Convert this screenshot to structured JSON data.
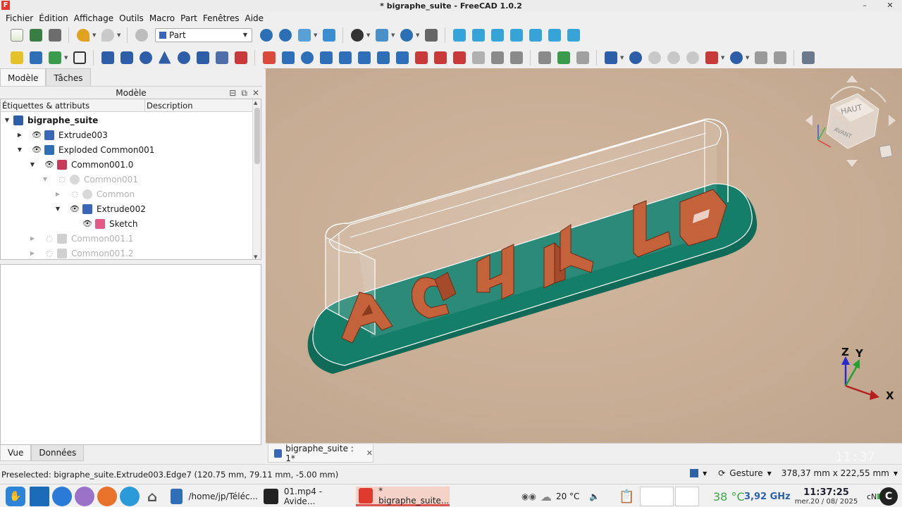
{
  "window": {
    "title": "* bigraphe_suite - FreeCAD 1.0.2",
    "minimize": "–",
    "close": "✕"
  },
  "menu": [
    "Fichier",
    "Édition",
    "Affichage",
    "Outils",
    "Macro",
    "Part",
    "Fenêtres",
    "Aide"
  ],
  "workbench": {
    "selected": "Part"
  },
  "left_panel": {
    "top_tabs": [
      "Modèle",
      "Tâches"
    ],
    "model_header": "Modèle",
    "columns": [
      "Étiquettes & attributs",
      "Description"
    ],
    "tree": [
      {
        "label": "bigraphe_suite",
        "bold": true
      },
      {
        "label": "Extrude003"
      },
      {
        "label": "Exploded Common001"
      },
      {
        "label": "Common001.0"
      },
      {
        "label": "Common001"
      },
      {
        "label": "Common"
      },
      {
        "label": "Extrude002"
      },
      {
        "label": "Sketch"
      },
      {
        "label": "Common001.1"
      },
      {
        "label": "Common001.2"
      }
    ],
    "bottom_tabs": [
      "Vue",
      "Données"
    ]
  },
  "navcube": {
    "top_face": "HAUT",
    "front_face": "AVANT"
  },
  "axes": {
    "x": "X",
    "y": "Y",
    "z": "Z"
  },
  "doc_tab": {
    "label": "bigraphe_suite : 1*"
  },
  "overlay_time": "11:37",
  "status": {
    "preselected": "Preselected: bigraphe_suite.Extrude003.Edge7 (120.75 mm, 79.11 mm, -5.00 mm)",
    "nav_style": "Gesture",
    "dimensions": "378,37 mm x 222,55 mm"
  },
  "taskbar": {
    "tasks": [
      {
        "label": "/home/jp/Téléc..."
      },
      {
        "label": "01.mp4 - Avide..."
      },
      {
        "label": "* bigraphe_suite..."
      }
    ],
    "weather_temp": "20 °C",
    "cpu_temp": "38 °C",
    "cpu_freq": "3,92 GHz",
    "clock_time": "11:37:25",
    "clock_date": "mer.20 / 08/ 2025",
    "tray_label": "cN"
  },
  "colors": {
    "view_bg": "#c8ad95",
    "base_green": "#137a66",
    "letters": "#c4623c"
  }
}
